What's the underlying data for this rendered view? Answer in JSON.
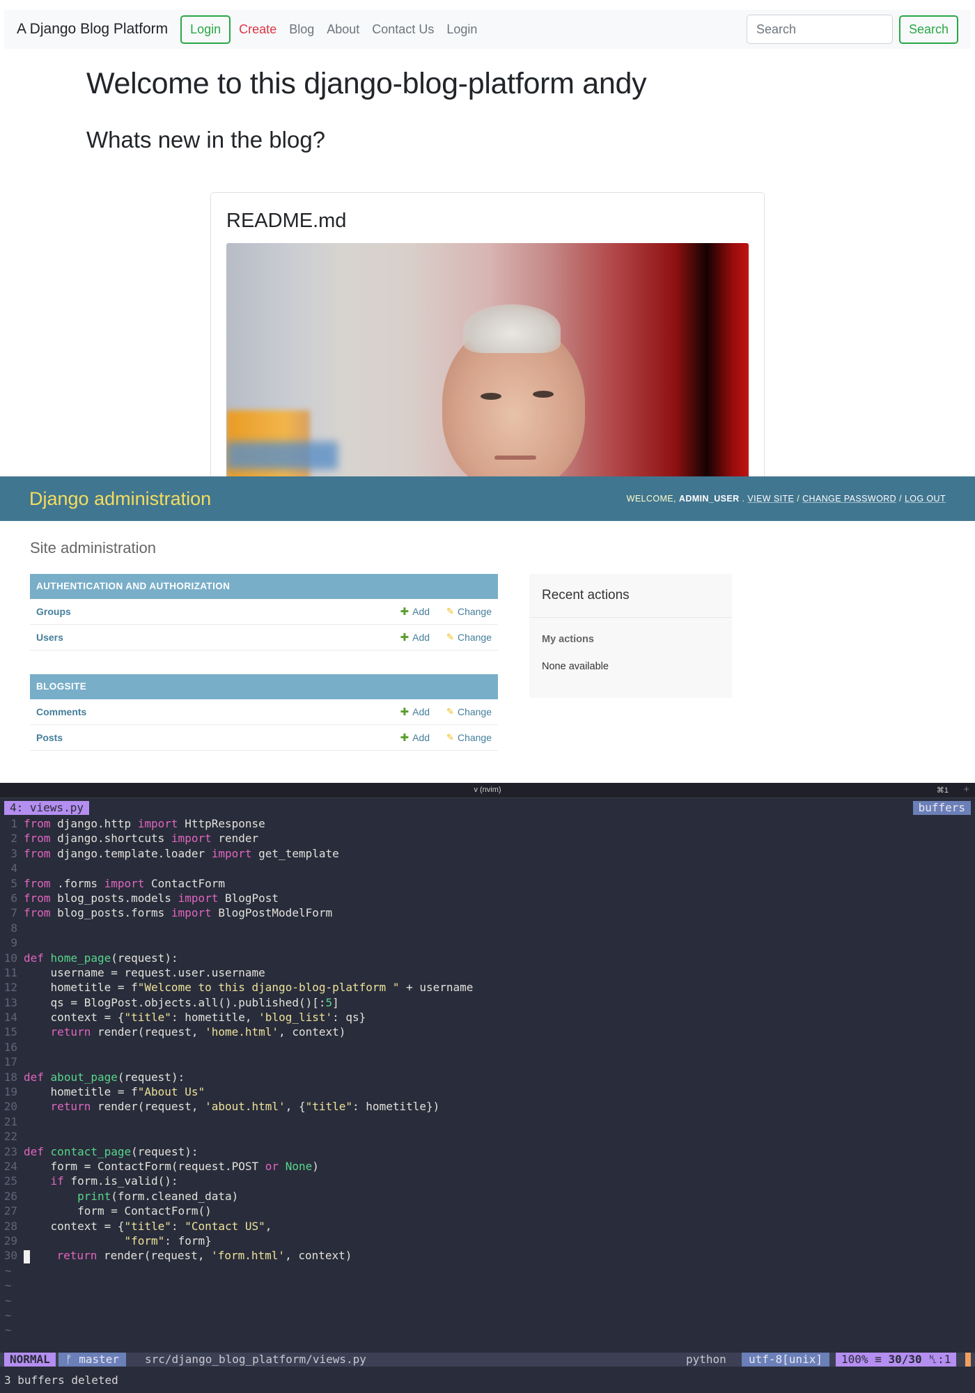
{
  "blog": {
    "navbar": {
      "brand": "A Django Blog Platform",
      "login_button": "Login",
      "links": [
        "Create",
        "Blog",
        "About",
        "Contact Us",
        "Login"
      ],
      "search_placeholder": "Search",
      "search_button": "Search"
    },
    "heading": "Welcome to this django-blog-platform andy",
    "subheading": "Whats new in the blog?",
    "card": {
      "title": "README.md"
    },
    "colors": {
      "accent_green": "#28a745",
      "active_link": "#dc3545"
    }
  },
  "admin": {
    "brand": "Django administration",
    "user_tools": {
      "welcome": "WELCOME,",
      "user": "ADMIN_USER",
      "view_site": "VIEW SITE",
      "change_password": "CHANGE PASSWORD",
      "log_out": "LOG OUT",
      "separator": "/"
    },
    "page_title": "Site administration",
    "modules": [
      {
        "caption": "AUTHENTICATION AND AUTHORIZATION",
        "rows": [
          {
            "name": "Groups"
          },
          {
            "name": "Users"
          }
        ]
      },
      {
        "caption": "BLOGSITE",
        "rows": [
          {
            "name": "Comments"
          },
          {
            "name": "Posts"
          }
        ]
      }
    ],
    "add_label": "Add",
    "change_label": "Change",
    "recent": {
      "title": "Recent actions",
      "my_actions": "My actions",
      "none": "None available"
    },
    "colors": {
      "header_bg": "#417690",
      "brand": "#f5dd5d",
      "caption_bg": "#79aec8",
      "link": "#447e9b"
    }
  },
  "terminal": {
    "title": "v (nvim)",
    "shortcut": "⌘1",
    "new_tab": "+",
    "buffer_tab": "4: views.py",
    "buffers_label": "buffers",
    "code": [
      [
        [
          "k",
          "from"
        ],
        [
          "p",
          " django.http "
        ],
        [
          "k",
          "import"
        ],
        [
          "p",
          " HttpResponse"
        ]
      ],
      [
        [
          "k",
          "from"
        ],
        [
          "p",
          " django.shortcuts "
        ],
        [
          "k",
          "import"
        ],
        [
          "p",
          " render"
        ]
      ],
      [
        [
          "k",
          "from"
        ],
        [
          "p",
          " django.template.loader "
        ],
        [
          "k",
          "import"
        ],
        [
          "p",
          " get_template"
        ]
      ],
      [],
      [
        [
          "k",
          "from"
        ],
        [
          "p",
          " .forms "
        ],
        [
          "k",
          "import"
        ],
        [
          "p",
          " ContactForm"
        ]
      ],
      [
        [
          "k",
          "from"
        ],
        [
          "p",
          " blog_posts.models "
        ],
        [
          "k",
          "import"
        ],
        [
          "p",
          " BlogPost"
        ]
      ],
      [
        [
          "k",
          "from"
        ],
        [
          "p",
          " blog_posts.forms "
        ],
        [
          "k",
          "import"
        ],
        [
          "p",
          " BlogPostModelForm"
        ]
      ],
      [],
      [],
      [
        [
          "k",
          "def"
        ],
        [
          "p",
          " "
        ],
        [
          "f",
          "home_page"
        ],
        [
          "p",
          "(request):"
        ]
      ],
      [
        [
          "p",
          "    username = request.user.username"
        ]
      ],
      [
        [
          "p",
          "    hometitle = f"
        ],
        [
          "s",
          "\"Welcome to this django-blog-platform \""
        ],
        [
          "p",
          " + username"
        ]
      ],
      [
        [
          "p",
          "    qs = BlogPost.objects.all().published()[:"
        ],
        [
          "n",
          "5"
        ],
        [
          "p",
          "]"
        ]
      ],
      [
        [
          "p",
          "    context = {"
        ],
        [
          "s",
          "\"title\""
        ],
        [
          "p",
          ": hometitle, "
        ],
        [
          "s",
          "'blog_list'"
        ],
        [
          "p",
          ": qs}"
        ]
      ],
      [
        [
          "k",
          "    return"
        ],
        [
          "p",
          " render(request, "
        ],
        [
          "s",
          "'home.html'"
        ],
        [
          "p",
          ", context)"
        ]
      ],
      [],
      [],
      [
        [
          "k",
          "def"
        ],
        [
          "p",
          " "
        ],
        [
          "f",
          "about_page"
        ],
        [
          "p",
          "(request):"
        ]
      ],
      [
        [
          "p",
          "    hometitle = f"
        ],
        [
          "s",
          "\"About Us\""
        ]
      ],
      [
        [
          "k",
          "    return"
        ],
        [
          "p",
          " render(request, "
        ],
        [
          "s",
          "'about.html'"
        ],
        [
          "p",
          ", {"
        ],
        [
          "s",
          "\"title\""
        ],
        [
          "p",
          ": hometitle})"
        ]
      ],
      [],
      [],
      [
        [
          "k",
          "def"
        ],
        [
          "p",
          " "
        ],
        [
          "f",
          "contact_page"
        ],
        [
          "p",
          "(request):"
        ]
      ],
      [
        [
          "p",
          "    form = ContactForm(request.POST "
        ],
        [
          "k",
          "or"
        ],
        [
          "p",
          " "
        ],
        [
          "b",
          "None"
        ],
        [
          "p",
          ")"
        ]
      ],
      [
        [
          "k",
          "    if"
        ],
        [
          "p",
          " form.is_valid():"
        ]
      ],
      [
        [
          "p",
          "        "
        ],
        [
          "b",
          "print"
        ],
        [
          "p",
          "(form.cleaned_data)"
        ]
      ],
      [
        [
          "p",
          "        form = ContactForm()"
        ]
      ],
      [
        [
          "p",
          "    context = {"
        ],
        [
          "s",
          "\"title\""
        ],
        [
          "p",
          ": "
        ],
        [
          "s",
          "\"Contact US\""
        ],
        [
          "p",
          ","
        ]
      ],
      [
        [
          "p",
          "               "
        ],
        [
          "s",
          "\"form\""
        ],
        [
          "p",
          ": form}"
        ]
      ],
      [
        [
          "c",
          ""
        ],
        [
          "k",
          "    return"
        ],
        [
          "p",
          " render(request, "
        ],
        [
          "s",
          "'form.html'"
        ],
        [
          "p",
          ", context)"
        ]
      ]
    ],
    "tilde_lines": 5,
    "status": {
      "mode": "NORMAL",
      "branch": "master",
      "path": "src/django_blog_platform/views.py",
      "filetype": "python",
      "encoding": "utf-8[unix]",
      "percent": "100%",
      "position": "30/30",
      "column": ":1"
    },
    "cmdline": "3 buffers deleted",
    "colors": {
      "bg": "#292c3a",
      "keyword": "#e066c0",
      "string": "#ede29a",
      "function": "#58d68d",
      "mode_bg": "#b48ef0",
      "branch_bg": "#6b7fb8"
    }
  }
}
